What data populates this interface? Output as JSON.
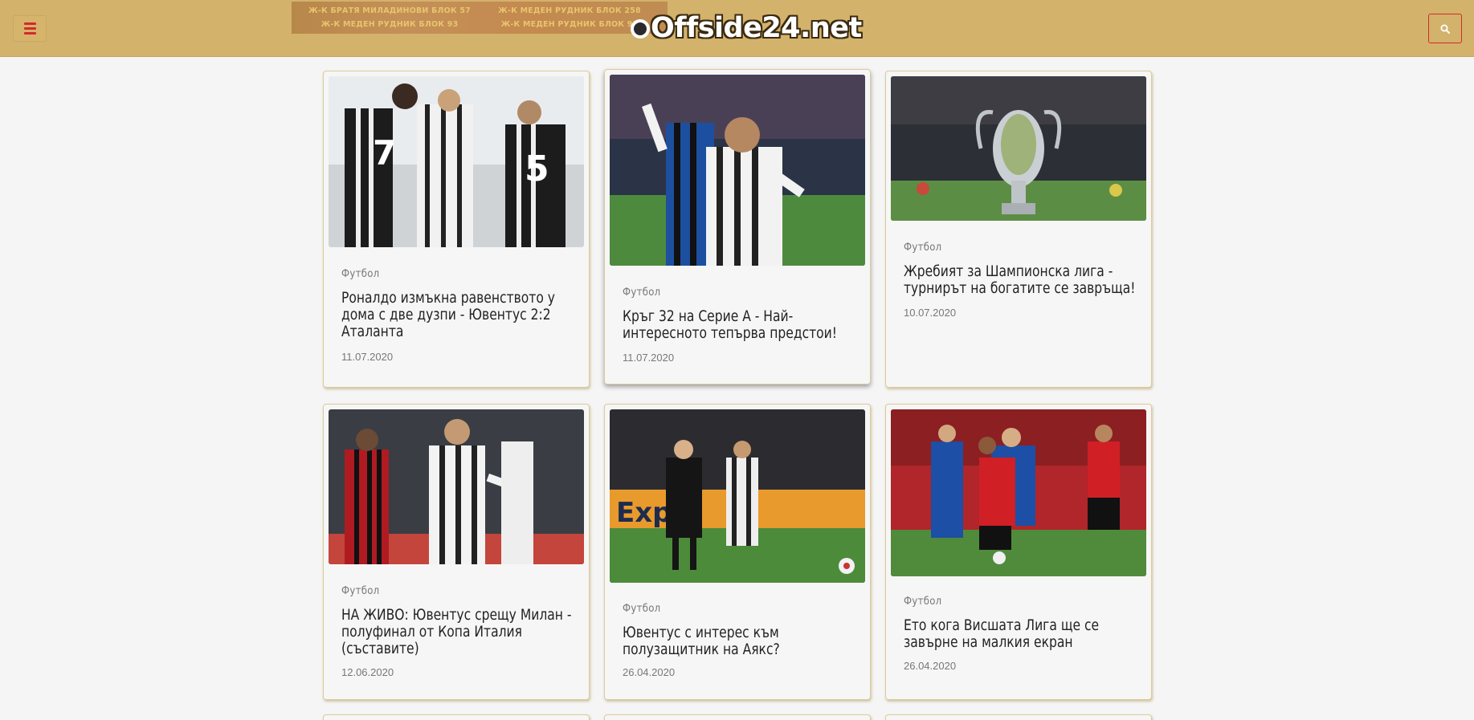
{
  "header": {
    "logo_text": "Offside24.net",
    "promo_lines": [
      "Ж-К БРАТЯ МИЛАДИНОВИ БЛОК 57",
      "Ж-К МЕДЕН РУДНИК БЛОК 258",
      "Ж-К МЕДЕН РУДНИК БЛОК 93",
      "Ж-К МЕДЕН РУДНИК БЛОК 93"
    ],
    "menu_icon": "hamburger-icon",
    "search_icon": "search-icon"
  },
  "colors": {
    "header_bg": "#d3b26b",
    "accent_red": "#d22b2b",
    "page_bg": "#f5f5f5"
  },
  "articles": [
    {
      "category": "Футбол",
      "title": "Роналдо измъкна равенството у дома с две дузпи - Ювентус 2:2 Аталанта",
      "date": "11.07.2020"
    },
    {
      "category": "Футбол",
      "title": "Кръг 32 на Серие А - Най-интересното тепърва предстои!",
      "date": "11.07.2020"
    },
    {
      "category": "Футбол",
      "title": "Жребият за Шампионска лига - турнирът на богатите се завръща!",
      "date": "10.07.2020"
    },
    {
      "category": "Футбол",
      "title": "НА ЖИВО: Ювентус срещу Милан - полуфинал от Копа Италия (съставите)",
      "date": "12.06.2020"
    },
    {
      "category": "Футбол",
      "title": "Ювентус с интерес към полузащитник на Аякс?",
      "date": "26.04.2020"
    },
    {
      "category": "Футбол",
      "title": "Ето кога Висшата Лига ще се завърне на малкия екран",
      "date": "26.04.2020"
    }
  ]
}
